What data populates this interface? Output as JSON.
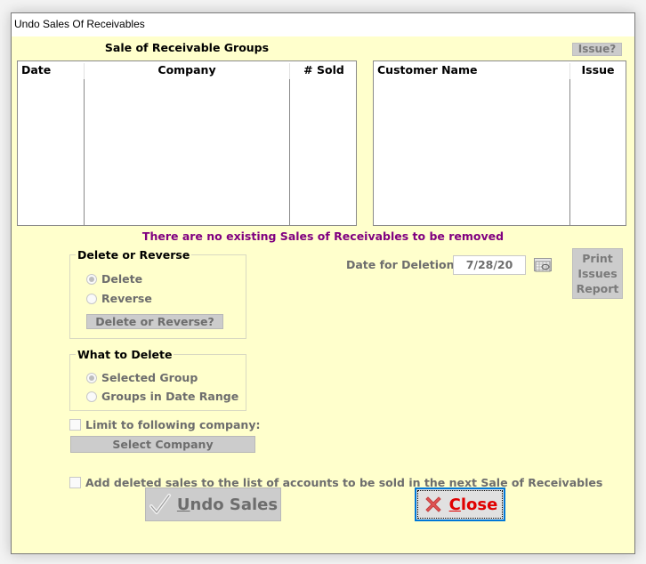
{
  "window": {
    "title": "Undo Sales Of Receivables"
  },
  "groups_list": {
    "title": "Sale of Receivable Groups",
    "columns": [
      "Date",
      "Company",
      "# Sold"
    ],
    "rows": []
  },
  "customers_list": {
    "issue_button": "Issue?",
    "columns": [
      "Customer Name",
      "Issue"
    ],
    "rows": []
  },
  "status_message": "There are no existing Sales of Receivables to be removed",
  "delete_or_reverse": {
    "legend": "Delete or Reverse",
    "options": [
      {
        "label": "Delete",
        "checked": true
      },
      {
        "label": "Reverse",
        "checked": false
      }
    ],
    "button": "Delete or Reverse?"
  },
  "what_to_delete": {
    "legend": "What to Delete",
    "options": [
      {
        "label": "Selected Group",
        "checked": true
      },
      {
        "label": "Groups in Date Range",
        "checked": false
      }
    ]
  },
  "limit_company": {
    "label": "Limit to following company:",
    "checked": false,
    "button": "Select Company"
  },
  "date_for_deletion": {
    "label": "Date for Deletion:",
    "value": "7/28/20",
    "calendar_icon": "calendar-icon"
  },
  "print_issues_button": {
    "lines": [
      "Print",
      "Issues",
      "Report"
    ]
  },
  "add_deleted_sales": {
    "label": "Add deleted sales to the list of accounts to be sold in the next Sale of Receivables",
    "checked": false
  },
  "buttons": {
    "undo": {
      "accel": "U",
      "rest": "ndo Sales",
      "icon": "checkmark-icon"
    },
    "close": {
      "accel": "C",
      "rest": "lose",
      "icon": "red-x-icon"
    }
  },
  "colors": {
    "background": "#ffffcc",
    "message": "#800080",
    "close_text": "#e00000",
    "focus_border": "#0078d7"
  }
}
